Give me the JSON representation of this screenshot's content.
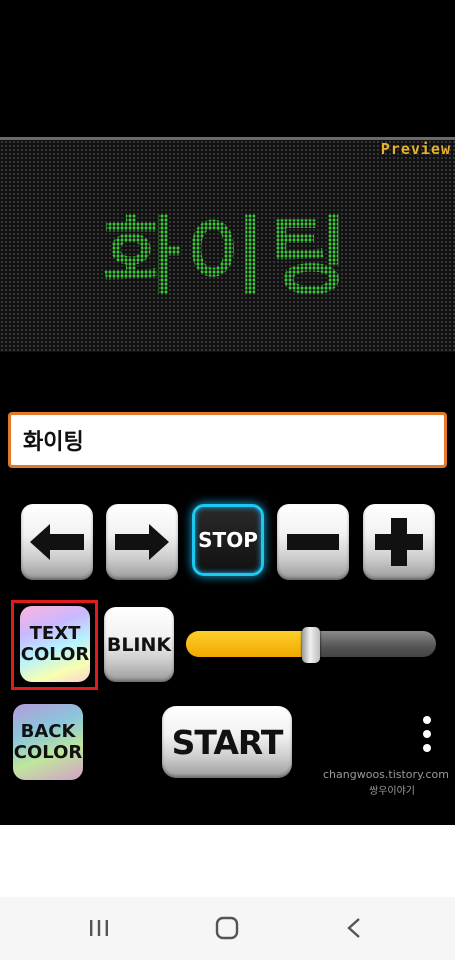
{
  "preview": {
    "label": "Preview",
    "display_text": "화이팅",
    "text_color": "#33cc33"
  },
  "input": {
    "value": "화이팅"
  },
  "controls": {
    "left_icon": "arrow-left-icon",
    "right_icon": "arrow-right-icon",
    "stop_label": "STOP",
    "minus_icon": "minus-icon",
    "plus_icon": "plus-icon"
  },
  "text_color_button": {
    "line1": "TEXT",
    "line2": "COLOR"
  },
  "blink_button": {
    "label": "BLINK"
  },
  "speed_slider": {
    "value_fraction": 0.5,
    "fill_color": "#f7b600"
  },
  "back_color_button": {
    "line1": "BACK",
    "line2": "COLOR"
  },
  "start_button": {
    "label": "START"
  },
  "menu_icon": "more-vertical-icon",
  "watermark": {
    "site": "changwoos.tistory.com",
    "name": "쌍우이야기"
  },
  "navigation": {
    "recents_icon": "recent-apps-icon",
    "home_icon": "home-icon",
    "back_icon": "back-icon"
  }
}
